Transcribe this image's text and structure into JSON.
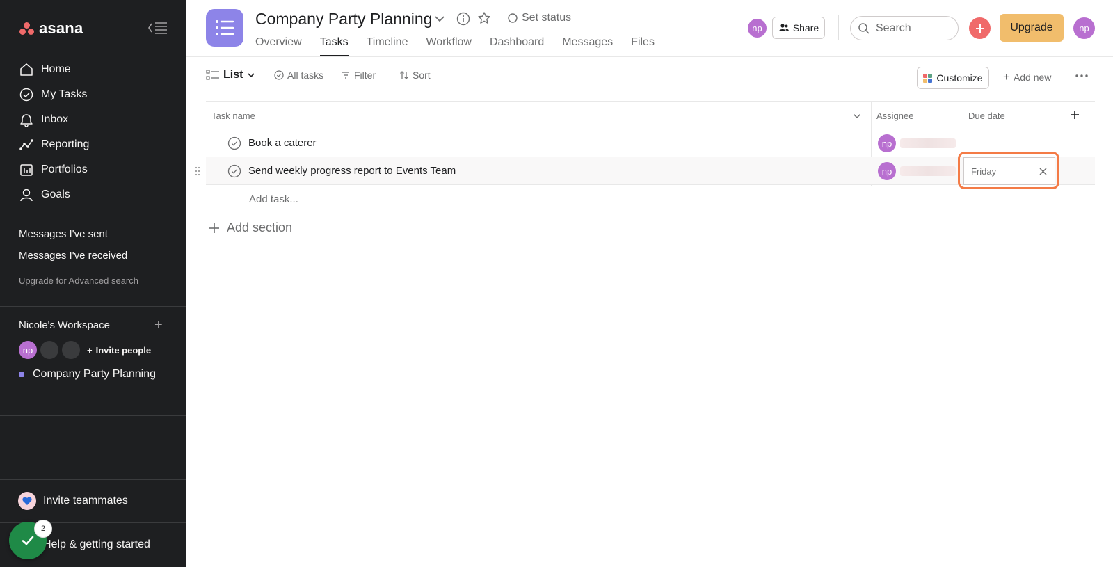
{
  "sidebar": {
    "logo_text": "asana",
    "nav": [
      {
        "label": "Home",
        "icon": "home-icon"
      },
      {
        "label": "My Tasks",
        "icon": "check-circle-icon"
      },
      {
        "label": "Inbox",
        "icon": "bell-icon"
      },
      {
        "label": "Reporting",
        "icon": "reporting-icon"
      },
      {
        "label": "Portfolios",
        "icon": "portfolio-icon"
      },
      {
        "label": "Goals",
        "icon": "goals-icon"
      }
    ],
    "messages_sent": "Messages I've sent",
    "messages_received": "Messages I've received",
    "upgrade_search": "Upgrade for Advanced search",
    "workspace": {
      "title": "Nicole's Workspace",
      "member_initials": "np",
      "invite_label": "Invite people",
      "project": "Company Party Planning",
      "project_color": "#8d84e8"
    },
    "invite_teammates": "Invite teammates",
    "help": "Help & getting started",
    "help_badge": "2"
  },
  "header": {
    "title": "Company Party Planning",
    "set_status": "Set status",
    "tabs": [
      "Overview",
      "Tasks",
      "Timeline",
      "Workflow",
      "Dashboard",
      "Messages",
      "Files"
    ],
    "active_tab": "Tasks",
    "member_initials": "np",
    "share_label": "Share",
    "search_placeholder": "Search",
    "upgrade_label": "Upgrade",
    "user_initials": "np"
  },
  "toolbar": {
    "view_label": "List",
    "all_tasks": "All tasks",
    "filter": "Filter",
    "sort": "Sort",
    "customize": "Customize",
    "add_new": "Add new"
  },
  "table": {
    "columns": {
      "task_name": "Task name",
      "assignee": "Assignee",
      "due_date": "Due date"
    },
    "rows": [
      {
        "name": "Book a caterer",
        "assignee_initials": "np",
        "due": ""
      },
      {
        "name": "Send weekly progress report to Events Team",
        "assignee_initials": "np",
        "due": "Friday"
      }
    ],
    "add_task": "Add task...",
    "add_section": "Add section"
  },
  "colors": {
    "sidebar_bg": "#1e1f21",
    "accent_coral": "#f06a6a",
    "upgrade_bg": "#f1bd6c",
    "project_purple": "#8d84e8",
    "avatar_purple": "#b86fd0",
    "highlight_orange": "#f47b46",
    "help_green": "#1f8a47"
  }
}
